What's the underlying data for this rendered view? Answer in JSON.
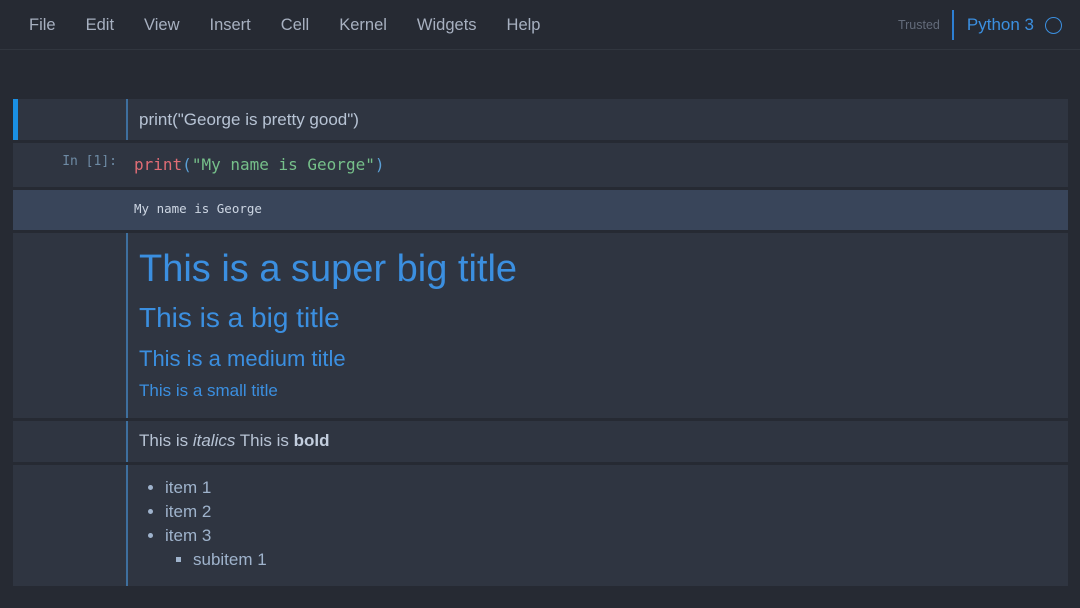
{
  "menubar": {
    "items": [
      {
        "label": "File",
        "name": "menu-file"
      },
      {
        "label": "Edit",
        "name": "menu-edit"
      },
      {
        "label": "View",
        "name": "menu-view"
      },
      {
        "label": "Insert",
        "name": "menu-insert"
      },
      {
        "label": "Cell",
        "name": "menu-cell"
      },
      {
        "label": "Kernel",
        "name": "menu-kernel"
      },
      {
        "label": "Widgets",
        "name": "menu-widgets"
      },
      {
        "label": "Help",
        "name": "menu-help"
      }
    ],
    "trusted_label": "Trusted",
    "kernel_name": "Python 3",
    "kernel_indicator_icon": "circle-idle-icon"
  },
  "colors": {
    "page_background": "#262a33",
    "cell_background": "#2f3541",
    "output_background": "#39455a",
    "accent_blue": "#3b8fe0",
    "selected_bar": "#1a8fe3",
    "menu_text": "#a7b0c0",
    "body_text": "#b7c3d4",
    "string_green": "#76c08a",
    "function_red": "#e06c75",
    "punct_blue": "#5b9fd6"
  },
  "cells": [
    {
      "type": "markdown-raw",
      "selected": true,
      "prompt": "",
      "text": "print(\"George is pretty good\")"
    },
    {
      "type": "code",
      "selected": false,
      "prompt": "In [1]:",
      "tokens": [
        {
          "t": "print",
          "k": "fn"
        },
        {
          "t": "(",
          "k": "punc"
        },
        {
          "t": "\"My name is George\"",
          "k": "str"
        },
        {
          "t": ")",
          "k": "punc"
        }
      ],
      "output": "My name is George"
    },
    {
      "type": "markdown-headings",
      "selected": false,
      "prompt": "",
      "headings": [
        {
          "level": 1,
          "text": "This is a super big title"
        },
        {
          "level": 2,
          "text": "This is a big title"
        },
        {
          "level": 3,
          "text": "This is a medium title"
        },
        {
          "level": 4,
          "text": "This is a small title"
        }
      ]
    },
    {
      "type": "markdown-emphasis",
      "selected": false,
      "prompt": "",
      "parts": [
        {
          "t": "This is ",
          "style": "normal"
        },
        {
          "t": "italics",
          "style": "italic"
        },
        {
          "t": " This is ",
          "style": "normal"
        },
        {
          "t": "bold",
          "style": "bold"
        }
      ]
    },
    {
      "type": "markdown-list",
      "selected": false,
      "prompt": "",
      "items": [
        {
          "text": "item 1",
          "children": []
        },
        {
          "text": "item 2",
          "children": []
        },
        {
          "text": "item 3",
          "children": [
            "subitem 1"
          ]
        }
      ]
    }
  ]
}
